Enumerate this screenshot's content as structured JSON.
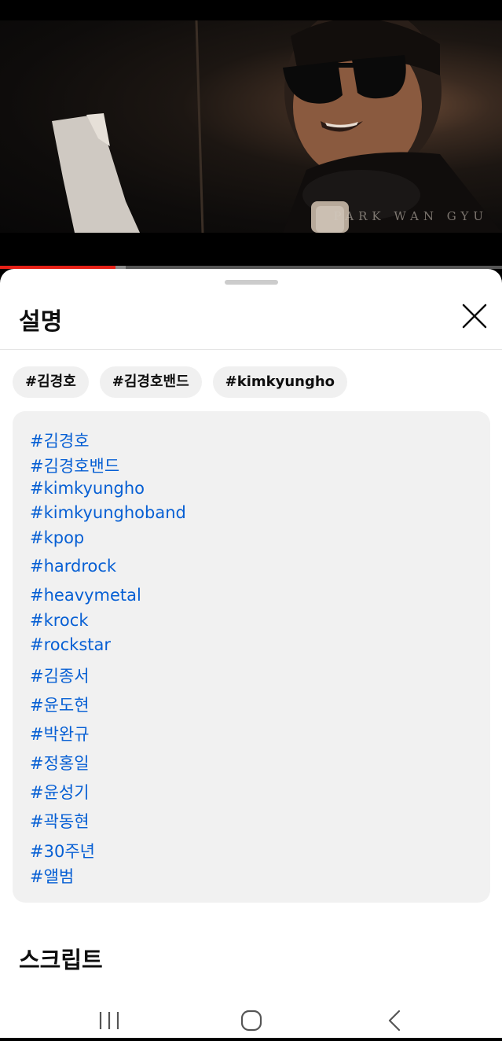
{
  "video": {
    "watermark": "PARK WAN GYU",
    "progress_fraction": 0.23,
    "buffer_fraction": 0.02
  },
  "sheet": {
    "title": "설명",
    "chips": [
      "#김경호",
      "#김경호밴드",
      "#kimkyungho"
    ],
    "description_tags": [
      "#김경호",
      "#김경호밴드",
      "#kimkyungho",
      "#kimkyunghoband",
      "#kpop",
      "#hardrock",
      "#heavymetal",
      "#krock",
      "#rockstar",
      "#김종서",
      "#윤도현",
      "#박완규",
      "#정홍일",
      "#윤성기",
      "#곽동현",
      "#30주년",
      "#앨범"
    ],
    "transcript_title": "스크립트"
  },
  "colors": {
    "link": "#065fd4",
    "progress": "#e62117",
    "chip_bg": "#f0f0f0",
    "box_bg": "#f1f1f1"
  },
  "icons": [
    "close-icon",
    "recent-apps-icon",
    "home-icon",
    "back-icon"
  ]
}
